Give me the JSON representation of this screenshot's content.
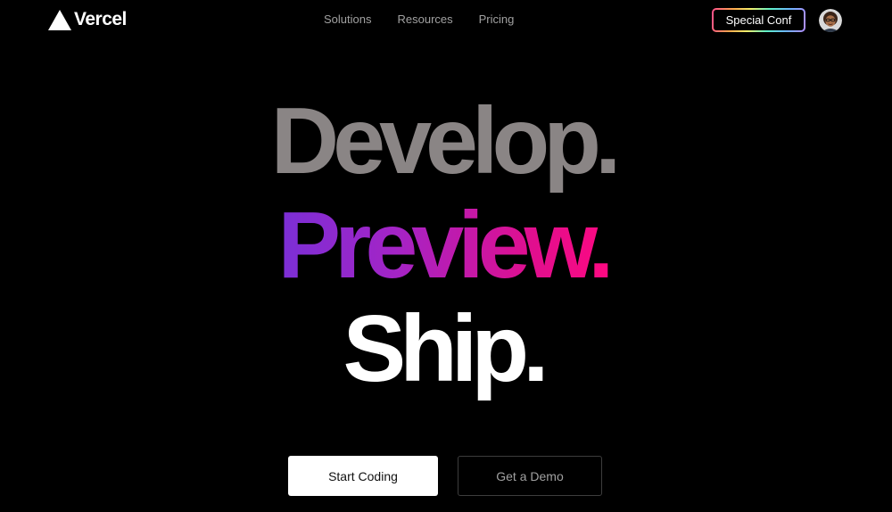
{
  "header": {
    "brand": "Vercel",
    "nav": [
      {
        "label": "Solutions"
      },
      {
        "label": "Resources"
      },
      {
        "label": "Pricing"
      }
    ],
    "conf_button": "Special Conf",
    "avatar_icon": "user-avatar-icon"
  },
  "hero": {
    "line1": "Develop.",
    "line2": "Preview.",
    "line3": "Ship."
  },
  "cta": {
    "primary": "Start Coding",
    "secondary": "Get a Demo"
  },
  "colors": {
    "background": "#000000",
    "develop": "#8a8585",
    "preview_start": "#7a2fd6",
    "preview_end": "#ff0880",
    "ship": "#ffffff",
    "nav_text": "#a1a1a1"
  }
}
